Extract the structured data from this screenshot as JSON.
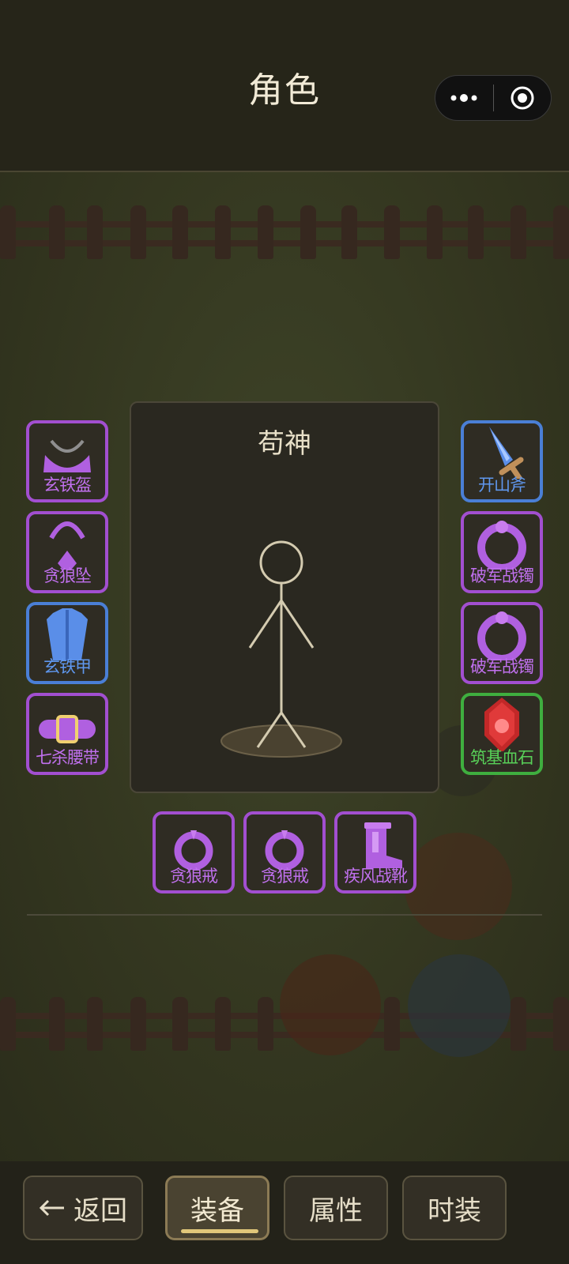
{
  "header": {
    "title": "角色",
    "menu_icon": "more-dots-icon",
    "close_icon": "target-circle-icon"
  },
  "character": {
    "name": "苟神"
  },
  "slots_left": [
    {
      "label": "玄铁盔",
      "quality": "purple",
      "icon": "helmet-icon"
    },
    {
      "label": "贪狼坠",
      "quality": "purple",
      "icon": "pendant-icon"
    },
    {
      "label": "玄铁甲",
      "quality": "blue",
      "icon": "armor-icon"
    },
    {
      "label": "七杀腰带",
      "quality": "purple",
      "icon": "belt-icon"
    }
  ],
  "slots_right": [
    {
      "label": "开山斧",
      "quality": "blue",
      "icon": "sword-icon"
    },
    {
      "label": "破军战镯",
      "quality": "purple",
      "icon": "bracelet-icon"
    },
    {
      "label": "破军战镯",
      "quality": "purple",
      "icon": "bracelet-icon"
    },
    {
      "label": "筑基血石",
      "quality": "green",
      "icon": "blood-gem-icon"
    }
  ],
  "slots_bottom": [
    {
      "label": "贪狼戒",
      "quality": "purple",
      "icon": "ring-icon"
    },
    {
      "label": "贪狼戒",
      "quality": "purple",
      "icon": "ring-icon"
    },
    {
      "label": "疾风战靴",
      "quality": "purple",
      "icon": "boot-icon"
    }
  ],
  "bottom_nav": {
    "back_label": "返回",
    "tabs": [
      "装备",
      "属性",
      "时装"
    ],
    "active_tab": "装备"
  },
  "colors": {
    "purple": "#a24fd0",
    "blue": "#4a7fd6",
    "green": "#3fae3f",
    "accent": "#e1c77a"
  }
}
